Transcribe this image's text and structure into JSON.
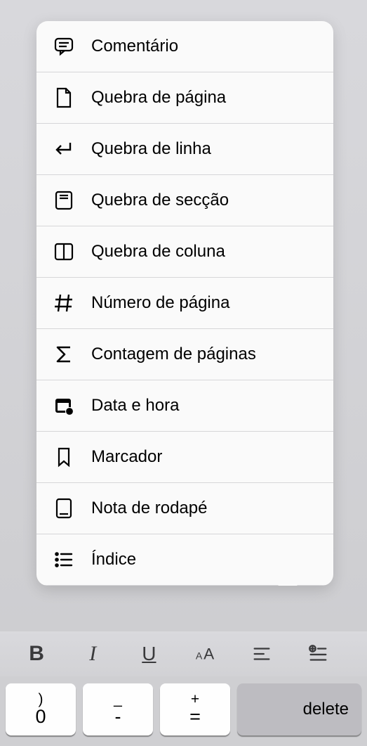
{
  "menu": {
    "items": [
      {
        "icon": "comment-icon",
        "label": "Comentário"
      },
      {
        "icon": "page-break-icon",
        "label": "Quebra de página"
      },
      {
        "icon": "line-break-icon",
        "label": "Quebra de linha"
      },
      {
        "icon": "section-break-icon",
        "label": "Quebra de secção"
      },
      {
        "icon": "column-break-icon",
        "label": "Quebra de coluna"
      },
      {
        "icon": "hash-icon",
        "label": "Número de página"
      },
      {
        "icon": "sigma-icon",
        "label": "Contagem de páginas"
      },
      {
        "icon": "calendar-icon",
        "label": "Data e hora"
      },
      {
        "icon": "bookmark-icon",
        "label": "Marcador"
      },
      {
        "icon": "footnote-icon",
        "label": "Nota de rodapé"
      },
      {
        "icon": "toc-icon",
        "label": "Índice"
      }
    ]
  },
  "format_toolbar": {
    "bold": "B",
    "italic": "I",
    "underline": "U",
    "textsize": "AA"
  },
  "keyboard": {
    "keys": [
      {
        "top": ")",
        "bottom": "0"
      },
      {
        "top": "_",
        "bottom": "-"
      },
      {
        "top": "+",
        "bottom": "="
      }
    ],
    "delete_label": "delete"
  }
}
